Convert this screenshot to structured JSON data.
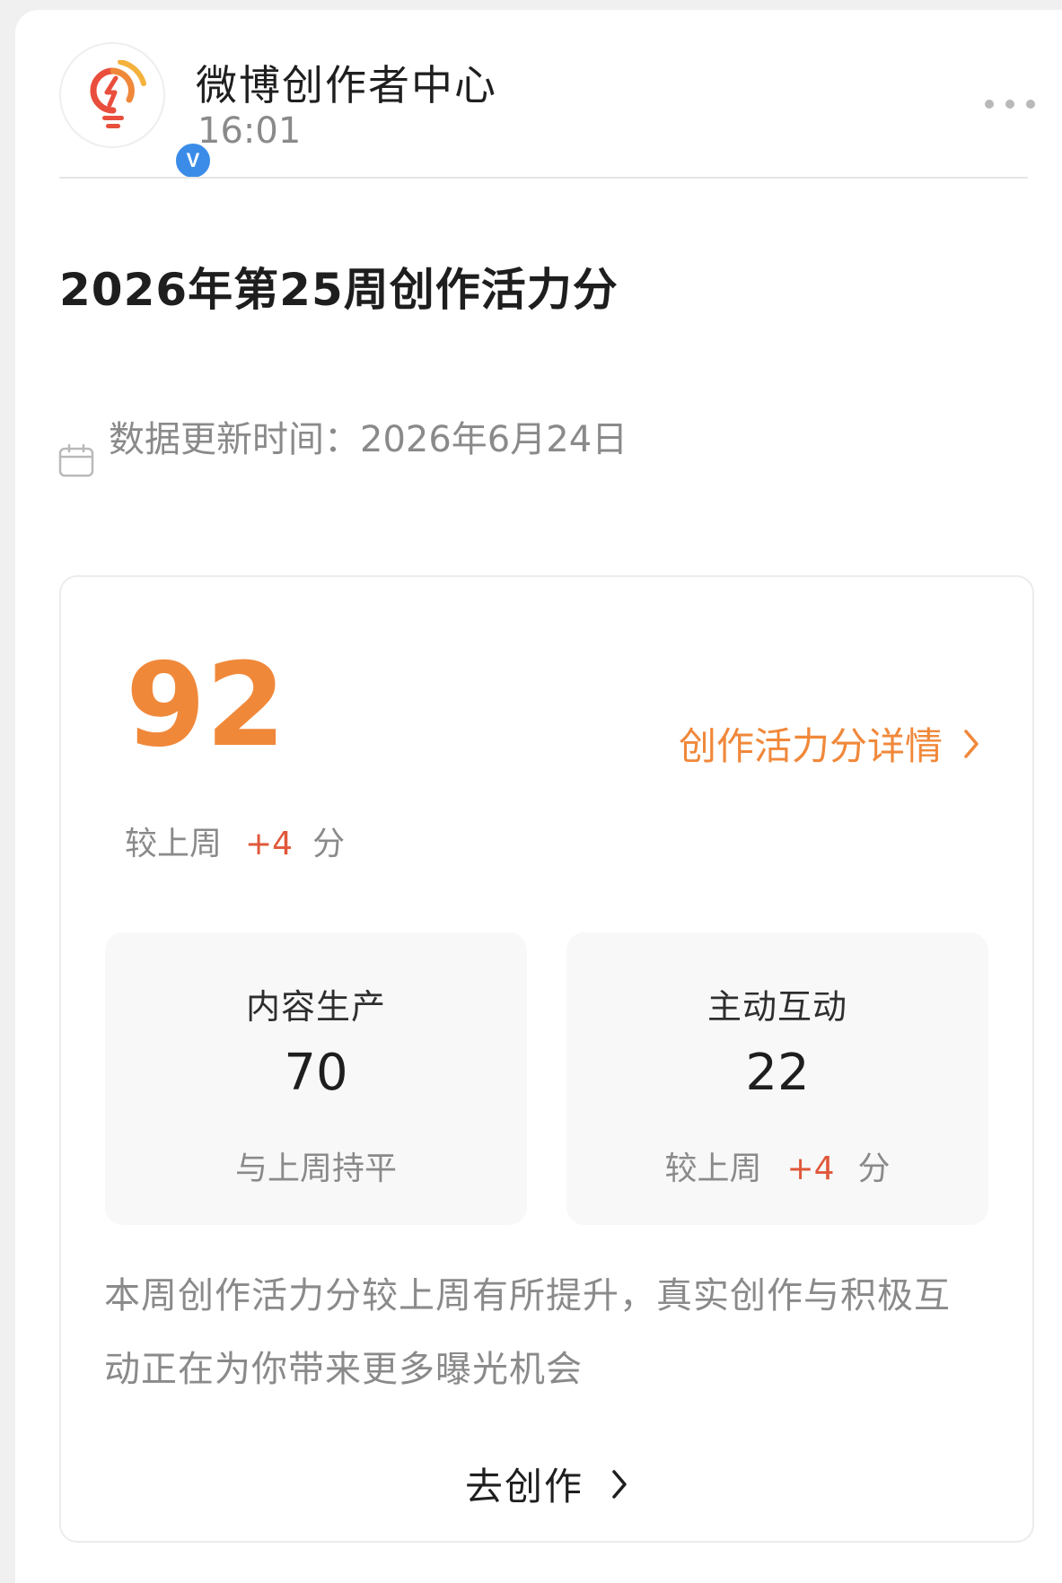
{
  "header": {
    "account_name": "微博创作者中心",
    "post_time": "16:01",
    "verified_mark": "V",
    "logo_colors": [
      "#f0883a",
      "#e94e3c"
    ],
    "verify_color": "#3a8ce8"
  },
  "post": {
    "title": "2026年第25周创作活力分",
    "update_time": "数据更新时间：2026年6月24日"
  },
  "score": {
    "total": "92",
    "detail_link": "创作活力分详情",
    "compare_prefix": "较上周",
    "compare_delta": "+4",
    "compare_suffix": "分",
    "accent_color": "#f0883a",
    "delta_color": "#e0583a"
  },
  "breakdown": [
    {
      "label": "内容生产",
      "value": "70",
      "note": "与上周持平"
    },
    {
      "label": "主动互动",
      "value": "22",
      "note_prefix": "较上周",
      "note_delta": "+4",
      "note_suffix": "分"
    }
  ],
  "summary": "本周创作活力分较上周有所提升，真实创作与积极互动正在为你带来更多曝光机会",
  "cta": {
    "label": "去创作"
  },
  "icons": [
    "lightbulb-logo-icon",
    "verified-icon",
    "more-icon",
    "calendar-icon",
    "chevron-right-icon"
  ]
}
